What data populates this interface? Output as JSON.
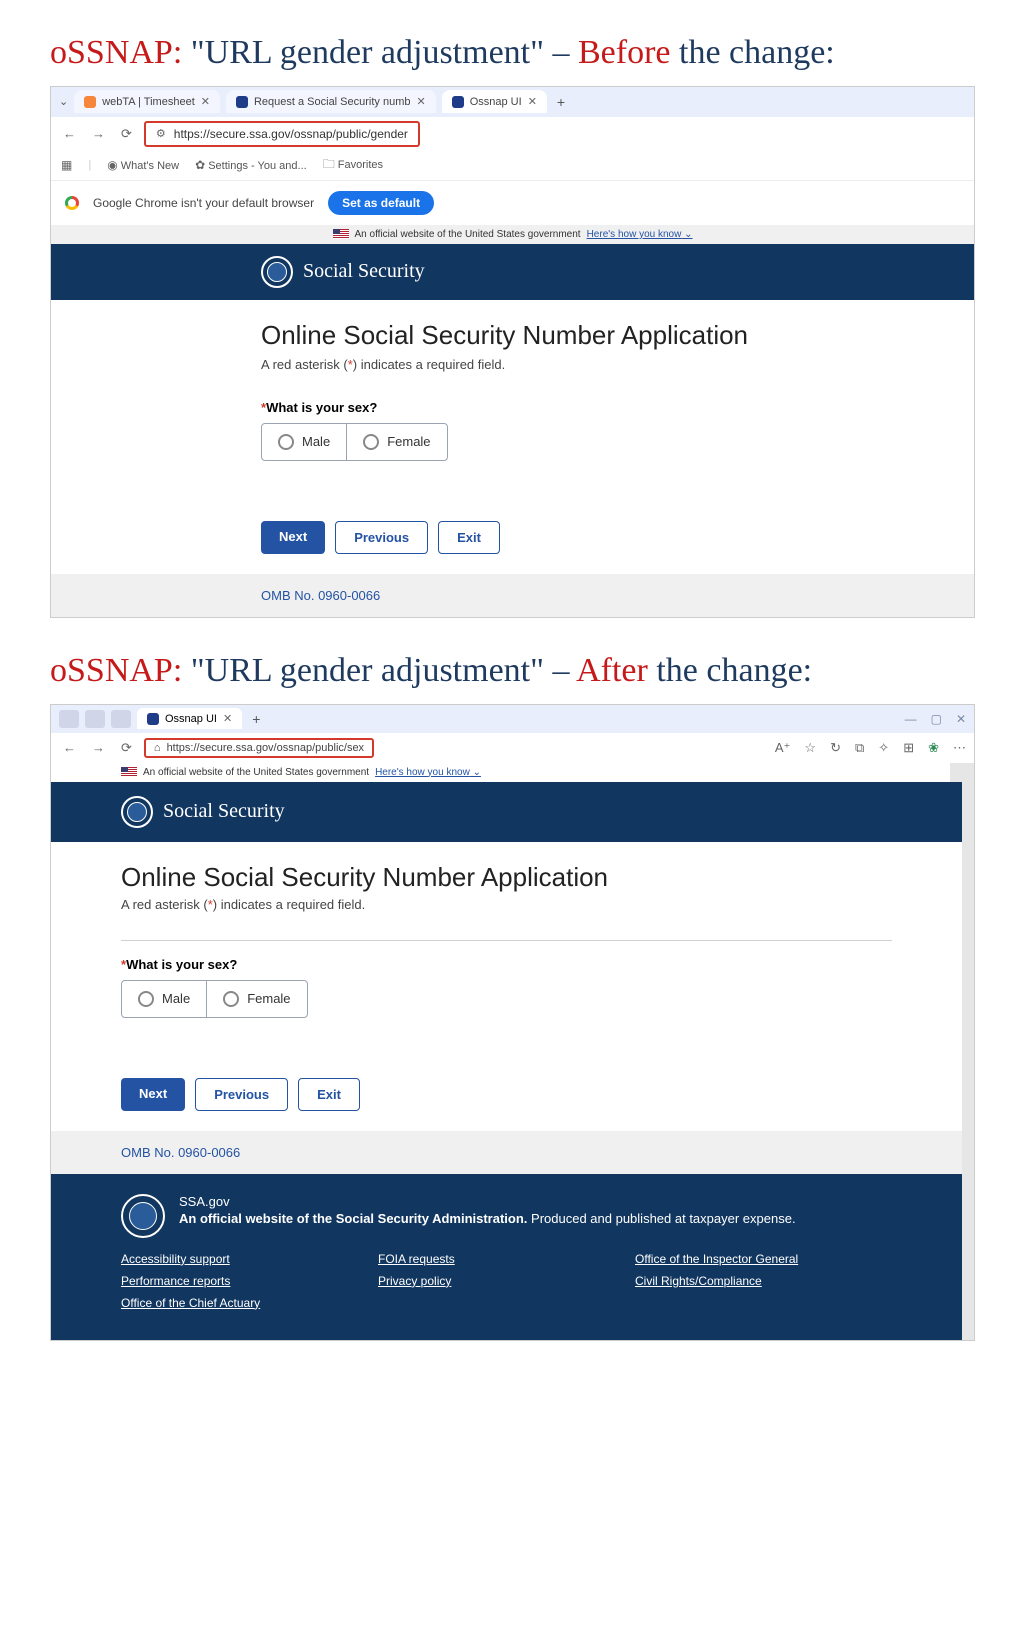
{
  "headings": {
    "before_prefix": "oSSNAP:",
    "before_quote": " \"URL gender adjustment\" – ",
    "before_word": "Before",
    "before_trail": " the change:",
    "after_prefix": "oSSNAP:",
    "after_quote": " \"URL gender adjustment\" – ",
    "after_word": "After",
    "after_trail": " the change:"
  },
  "before": {
    "tabs": [
      "webTA | Timesheet",
      "Request a Social Security numb",
      "Ossnap UI"
    ],
    "url": "https://secure.ssa.gov/ossnap/public/gender",
    "bookmarks": [
      "What's New",
      "Settings - You and...",
      "Favorites"
    ],
    "default_msg": "Google Chrome isn't your default browser",
    "default_btn": "Set as default",
    "gov_text": "An official website of the United States government",
    "gov_link": "Here's how you know",
    "brand": "Social Security",
    "app_title": "Online Social Security Number Application",
    "req_note_pre": "A red asterisk (",
    "req_note_ast": "*",
    "req_note_post": ") indicates a required field.",
    "question": "What is your sex?",
    "options": [
      "Male",
      "Female"
    ],
    "buttons": {
      "next": "Next",
      "prev": "Previous",
      "exit": "Exit"
    },
    "omb": "OMB No. 0960-0066"
  },
  "after": {
    "tab": "Ossnap UI",
    "url": "https://secure.ssa.gov/ossnap/public/sex",
    "gov_text": "An official website of the United States government",
    "gov_link": "Here's how you know",
    "brand": "Social Security",
    "app_title": "Online Social Security Number Application",
    "req_note_pre": "A red asterisk (",
    "req_note_ast": "*",
    "req_note_post": ") indicates a required field.",
    "question": "What is your sex?",
    "options": [
      "Male",
      "Female"
    ],
    "buttons": {
      "next": "Next",
      "prev": "Previous",
      "exit": "Exit"
    },
    "omb": "OMB No. 0960-0066",
    "footer": {
      "domain": "SSA.gov",
      "tagline_bold": "An official website of the Social Security Administration.",
      "tagline_rest": " Produced and published at taxpayer expense.",
      "col1": [
        "Accessibility support",
        "Performance reports",
        "Office of the Chief Actuary"
      ],
      "col2": [
        "FOIA requests",
        "Privacy policy"
      ],
      "col3": [
        "Office of the Inspector General",
        "Civil Rights/Compliance"
      ]
    }
  }
}
